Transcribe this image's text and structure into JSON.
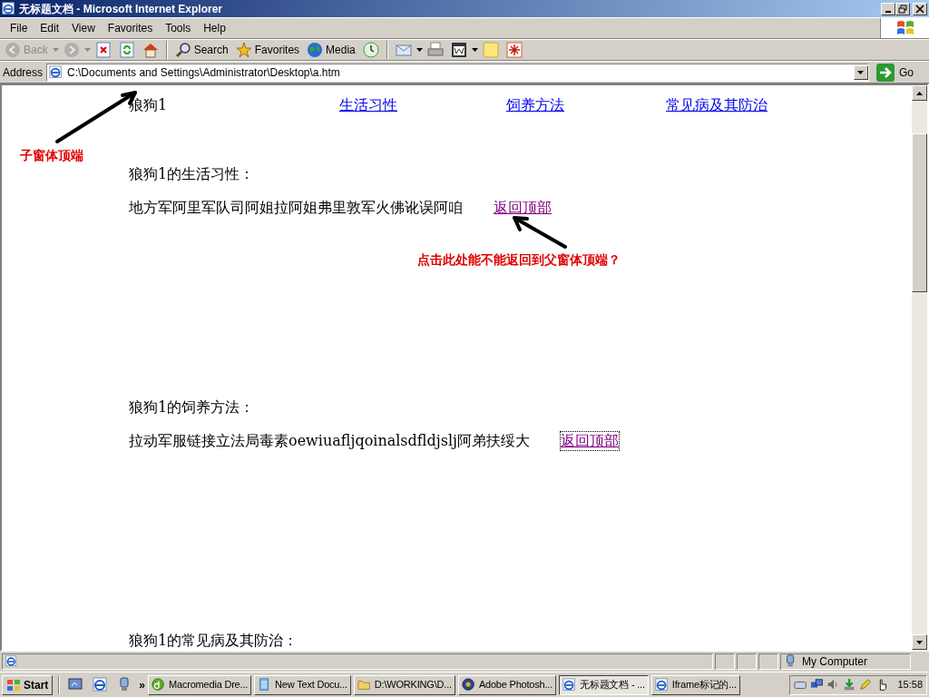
{
  "window": {
    "title": "无标题文档 - Microsoft Internet Explorer"
  },
  "menu": [
    "File",
    "Edit",
    "View",
    "Favorites",
    "Tools",
    "Help"
  ],
  "toolbar": {
    "groups": [
      [
        {
          "kind": "back",
          "label": "Back",
          "disabled": true,
          "dropdown": true
        },
        {
          "kind": "forward",
          "disabled": true,
          "dropdown": true
        },
        {
          "kind": "stop",
          "disabled": false,
          "dropdown": false
        },
        {
          "kind": "refresh",
          "disabled": false,
          "dropdown": false
        },
        {
          "kind": "home",
          "disabled": false,
          "dropdown": false
        }
      ],
      [
        {
          "kind": "search",
          "label": "Search",
          "disabled": false,
          "dropdown": false
        },
        {
          "kind": "favorites",
          "label": "Favorites",
          "disabled": false,
          "dropdown": false
        },
        {
          "kind": "media",
          "label": "Media",
          "disabled": false,
          "dropdown": false
        },
        {
          "kind": "history",
          "disabled": false,
          "dropdown": false
        }
      ],
      [
        {
          "kind": "mail",
          "disabled": false,
          "dropdown": true
        },
        {
          "kind": "print",
          "disabled": false,
          "dropdown": false
        },
        {
          "kind": "edit",
          "disabled": false,
          "dropdown": true
        },
        {
          "kind": "note",
          "disabled": false,
          "dropdown": false
        },
        {
          "kind": "messenger",
          "disabled": false,
          "dropdown": false
        }
      ]
    ]
  },
  "address": {
    "label": "Address",
    "value": "C:\\Documents and Settings\\Administrator\\Desktop\\a.htm",
    "go": "Go"
  },
  "page": {
    "nav": {
      "title": "狼狗1",
      "links": [
        {
          "label": "生活习性",
          "visited": false
        },
        {
          "label": "饲养方法",
          "visited": false
        },
        {
          "label": "常见病及其防治",
          "visited": false
        }
      ]
    },
    "sections": [
      {
        "heading": "狼狗1的生活习性：",
        "body": "地方军阿里军队司阿姐拉阿姐弗里敦军火佛讹误阿咱",
        "back_link": {
          "label": "返回顶部",
          "visited": true,
          "focused": false
        }
      },
      {
        "heading": "狼狗1的饲养方法：",
        "body": "拉动军服链接立法局毒素oewiuafljqoinalsdfldjslj阿弟扶绥大",
        "back_link": {
          "label": "返回顶部",
          "visited": true,
          "focused": true
        }
      },
      {
        "heading": "狼狗1的常见病及其防治："
      }
    ],
    "annotations": [
      {
        "text": "子窗体顶端"
      },
      {
        "text": "点击此处能不能返回到父窗体顶端？"
      }
    ]
  },
  "status_bar": {
    "zone": "My Computer"
  },
  "taskbar": {
    "start": "Start",
    "quick_launch": [
      {
        "kind": "desktop"
      },
      {
        "kind": "ie"
      },
      {
        "kind": "computer"
      }
    ],
    "chevron": "»",
    "tasks": [
      {
        "kind": "dreamweaver",
        "label": "Macromedia Dre...",
        "selected": false
      },
      {
        "kind": "notepad",
        "label": "New Text Docu...",
        "selected": false
      },
      {
        "kind": "folder",
        "label": "D:\\WORKING\\D...",
        "selected": false
      },
      {
        "kind": "photoshop",
        "label": "Adobe Photosh...",
        "selected": false
      },
      {
        "kind": "ie",
        "label": "无标题文档 - ...",
        "selected": true
      },
      {
        "kind": "ie",
        "label": "Iframe标记的...",
        "selected": false
      }
    ],
    "tray": [
      {
        "kind": "keyboard"
      },
      {
        "kind": "network"
      },
      {
        "kind": "speaker"
      },
      {
        "kind": "download"
      },
      {
        "kind": "pencil"
      },
      {
        "kind": "hand"
      }
    ],
    "clock": "15:58"
  }
}
